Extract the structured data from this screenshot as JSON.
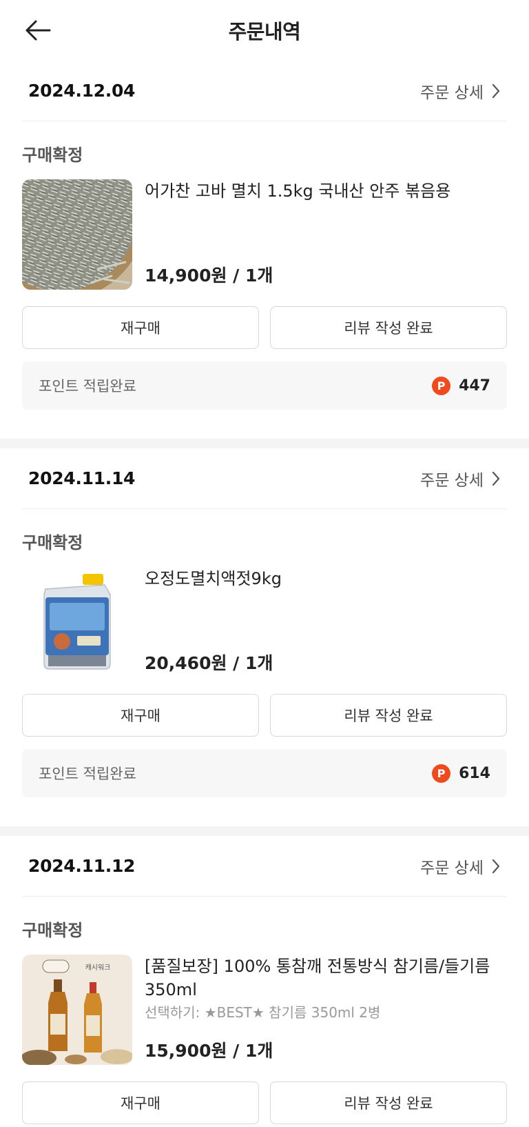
{
  "header": {
    "title": "주문내역"
  },
  "orders": [
    {
      "date": "2024.12.04",
      "detail_label": "주문 상세",
      "status": "구매확정",
      "product_name": "어가찬 고바 멸치 1.5kg 국내산 안주 볶음용",
      "option": "",
      "price": "14,900원 / 1개",
      "rebuy_label": "재구매",
      "review_label": "리뷰 작성 완료",
      "points_label": "포인트 적립완료",
      "points_badge": "P",
      "points": "447"
    },
    {
      "date": "2024.11.14",
      "detail_label": "주문 상세",
      "status": "구매확정",
      "product_name": "오정도멸치액젓9kg",
      "option": "",
      "price": "20,460원 / 1개",
      "rebuy_label": "재구매",
      "review_label": "리뷰 작성 완료",
      "points_label": "포인트 적립완료",
      "points_badge": "P",
      "points": "614"
    },
    {
      "date": "2024.11.12",
      "detail_label": "주문 상세",
      "status": "구매확정",
      "product_name": "[품질보장] 100% 통참깨 전통방식 참기름/들기름 350ml",
      "option": "선택하기: ★BEST★ 참기름 350ml 2병",
      "price": "15,900원 / 1개",
      "rebuy_label": "재구매",
      "review_label": "리뷰 작성 완료",
      "thumb_text": "캐시워크"
    }
  ],
  "icons": {
    "back": "arrow-left-icon",
    "chevron": "chevron-right-icon",
    "points": "point-badge-icon"
  },
  "colors": {
    "point_badge": "#ef4a1e",
    "divider": "#f4f4f4",
    "points_bg": "#f7f7f7"
  }
}
